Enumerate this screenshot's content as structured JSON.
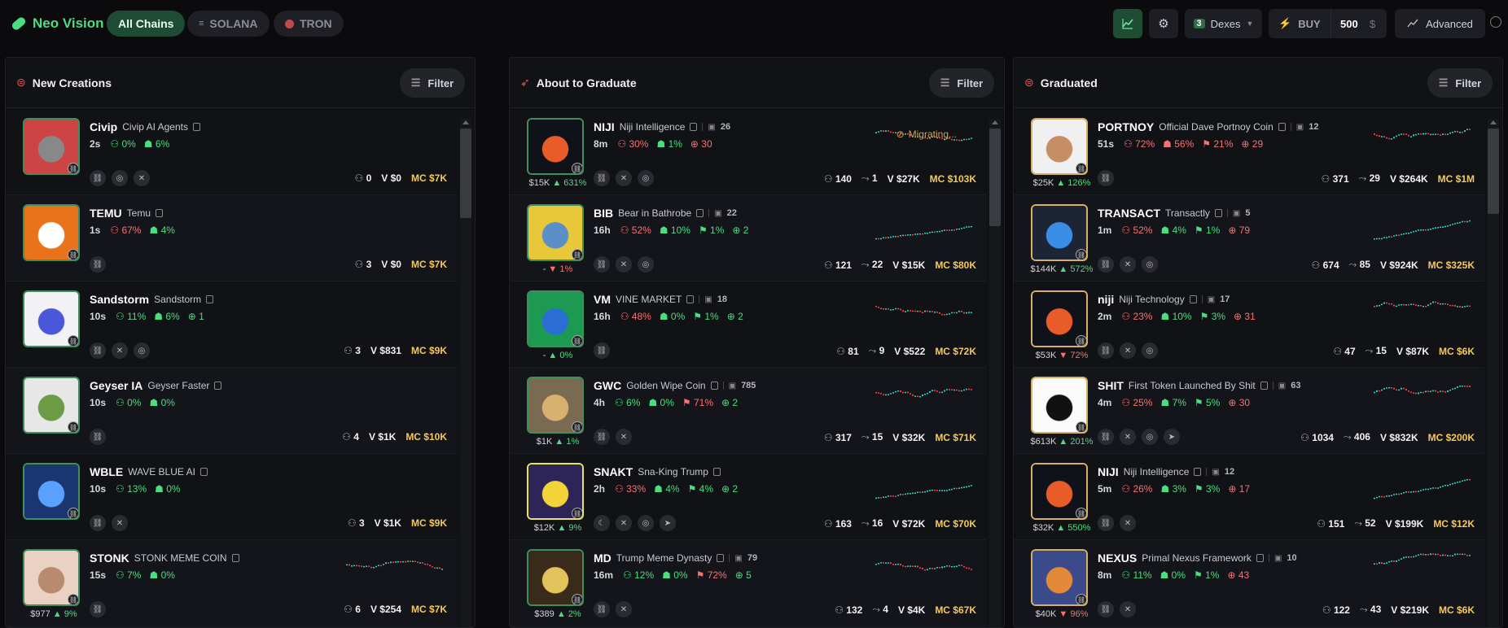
{
  "header": {
    "brand": "Neo Vision",
    "chains": [
      {
        "label": "All Chains"
      },
      {
        "label": "SOLANA"
      },
      {
        "label": "TRON"
      }
    ],
    "dexes_count": "3",
    "dexes_label": "Dexes",
    "buy_label": "BUY",
    "buy_amount": "500",
    "currency": "$",
    "advanced_label": "Advanced"
  },
  "columns": [
    {
      "title": "New Creations",
      "filter": "Filter",
      "rows": [
        {
          "ticker": "Civip",
          "name": "Civip AI Agents",
          "age": "2s",
          "holders": "0%",
          "dev": "6%",
          "socials": [
            "link",
            "web",
            "x"
          ],
          "h": "0",
          "v": "V $0",
          "mc": "MC $7K",
          "img": "#c44",
          "img2": "#888"
        },
        {
          "ticker": "TEMU",
          "name": "Temu",
          "age": "1s",
          "holders": "67%",
          "dev": "4%",
          "socials": [
            "link"
          ],
          "h": "3",
          "v": "V $0",
          "mc": "MC $7K",
          "img": "#e8731b",
          "img2": "#fff"
        },
        {
          "ticker": "Sandstorm",
          "name": "Sandstorm",
          "age": "10s",
          "holders": "11%",
          "dev": "6%",
          "extra": "1",
          "socials": [
            "link",
            "x",
            "web"
          ],
          "h": "3",
          "v": "V $831",
          "mc": "MC $9K",
          "img": "#f2f2f5",
          "img2": "#4a57d8"
        },
        {
          "ticker": "Geyser IA",
          "name": "Geyser Faster",
          "age": "10s",
          "holders": "0%",
          "dev": "0%",
          "socials": [
            "link"
          ],
          "h": "4",
          "v": "V $1K",
          "mc": "MC $10K",
          "img": "#e7e7e7",
          "img2": "#6c9b45"
        },
        {
          "ticker": "WBLE",
          "name": "WAVE BLUE AI",
          "age": "10s",
          "holders": "13%",
          "dev": "0%",
          "socials": [
            "link",
            "x"
          ],
          "h": "3",
          "v": "V $1K",
          "mc": "MC $9K",
          "img": "#1b3570",
          "img2": "#5aa0ff"
        },
        {
          "ticker": "STONK",
          "name": "STONK MEME COIN",
          "age": "15s",
          "holders": "7%",
          "dev": "0%",
          "socials": [
            "link"
          ],
          "h": "6",
          "v": "V $254",
          "mc": "MC $7K",
          "img": "#e9d2c2",
          "img2": "#b88a70",
          "mcap": "$977",
          "chg": "9%",
          "chgUp": true
        }
      ]
    },
    {
      "title": "About to Graduate",
      "filter": "Filter",
      "rows": [
        {
          "ticker": "NIJI",
          "name": "Niji Intelligence",
          "comments": "26",
          "age": "8m",
          "holders": "30%",
          "dev": "1%",
          "extra": "30",
          "socials": [
            "link",
            "x",
            "web"
          ],
          "h": "140",
          "tx": "1",
          "v": "V $27K",
          "mc": "MC $103K",
          "mig": "Migrating...",
          "mcap": "$15K",
          "chg": "631%",
          "chgUp": true,
          "img": "#0f1218",
          "img2": "#e85c2a"
        },
        {
          "ticker": "BIB",
          "name": "Bear in Bathrobe",
          "comments": "22",
          "age": "16h",
          "holders": "52%",
          "dev": "10%",
          "top": "1%",
          "extra": "2",
          "socials": [
            "link",
            "x",
            "web"
          ],
          "h": "121",
          "tx": "22",
          "v": "V $15K",
          "mc": "MC $80K",
          "mcap": "-",
          "chg": "1%",
          "chgUp": false,
          "img": "#e9c73a",
          "img2": "#5a8fc7"
        },
        {
          "ticker": "VM",
          "name": "VINE MARKET",
          "comments": "18",
          "age": "16h",
          "holders": "48%",
          "dev": "0%",
          "top": "1%",
          "extra": "2",
          "socials": [
            "link"
          ],
          "h": "81",
          "tx": "9",
          "v": "V $522",
          "mc": "MC $72K",
          "mcap": "-",
          "chg": "0%",
          "chgUp": true,
          "img": "#1d9a52",
          "img2": "#2a6ed4"
        },
        {
          "ticker": "GWC",
          "name": "Golden Wipe Coin",
          "comments": "785",
          "age": "4h",
          "holders": "6%",
          "dev": "0%",
          "top": "71%",
          "extra": "2",
          "socials": [
            "link",
            "x"
          ],
          "h": "317",
          "tx": "15",
          "v": "V $32K",
          "mc": "MC $71K",
          "mcap": "$1K",
          "chg": "1%",
          "chgUp": true,
          "img": "#7b6a52",
          "img2": "#d8b070"
        },
        {
          "ticker": "SNAKT",
          "name": "Sna-King Trump",
          "age": "2h",
          "holders": "33%",
          "dev": "4%",
          "top": "4%",
          "extra": "2",
          "socials": [
            "moon",
            "x",
            "web",
            "tg"
          ],
          "h": "163",
          "tx": "16",
          "v": "V $72K",
          "mc": "MC $70K",
          "mcap": "$12K",
          "chg": "9%",
          "chgUp": true,
          "img": "#2d2458",
          "img2": "#f3d33a"
        },
        {
          "ticker": "MD",
          "name": "Trump Meme Dynasty",
          "comments": "79",
          "age": "16m",
          "holders": "12%",
          "dev": "0%",
          "top": "72%",
          "extra": "5",
          "socials": [
            "link",
            "x"
          ],
          "h": "132",
          "tx": "4",
          "v": "V $4K",
          "mc": "MC $67K",
          "mcap": "$389",
          "chg": "2%",
          "chgUp": true,
          "img": "#3a2a1a",
          "img2": "#e2c25a"
        }
      ]
    },
    {
      "title": "Graduated",
      "filter": "Filter",
      "rows": [
        {
          "ticker": "PORTNOY",
          "name": "Official Dave Portnoy Coin",
          "comments": "12",
          "age": "51s",
          "holders": "72%",
          "dev": "56%",
          "top": "21%",
          "extra": "29",
          "socials": [
            "link"
          ],
          "h": "371",
          "tx": "29",
          "v": "V $264K",
          "mc": "MC $1M",
          "mcap": "$25K",
          "chg": "126%",
          "chgUp": true,
          "img": "#f0f0f0",
          "img2": "#c68e64"
        },
        {
          "ticker": "TRANSACT",
          "name": "Transactly",
          "comments": "5",
          "age": "1m",
          "holders": "52%",
          "dev": "4%",
          "top": "1%",
          "extra": "79",
          "socials": [
            "link",
            "x",
            "web"
          ],
          "h": "674",
          "tx": "85",
          "v": "V $924K",
          "mc": "MC $325K",
          "mcap": "$144K",
          "chg": "572%",
          "chgUp": true,
          "img": "#1c2436",
          "img2": "#3a8ee8"
        },
        {
          "ticker": "niji",
          "name": "Niji Technology",
          "comments": "17",
          "age": "2m",
          "holders": "23%",
          "dev": "10%",
          "top": "3%",
          "extra": "31",
          "socials": [
            "link",
            "x",
            "web"
          ],
          "h": "47",
          "tx": "15",
          "v": "V $87K",
          "mc": "MC $6K",
          "mcap": "$53K",
          "chg": "72%",
          "chgUp": false,
          "img": "#0f1218",
          "img2": "#e85c2a"
        },
        {
          "ticker": "SHIT",
          "name": "First Token Launched By Shit",
          "comments": "63",
          "age": "4m",
          "holders": "25%",
          "dev": "7%",
          "top": "5%",
          "extra": "30",
          "socials": [
            "link",
            "x",
            "web",
            "tg"
          ],
          "h": "1034",
          "tx": "406",
          "v": "V $832K",
          "mc": "MC $200K",
          "mcap": "$613K",
          "chg": "201%",
          "chgUp": true,
          "img": "#fafafa",
          "img2": "#111"
        },
        {
          "ticker": "NIJI",
          "name": "Niji Intelligence",
          "comments": "12",
          "age": "5m",
          "holders": "26%",
          "dev": "3%",
          "top": "3%",
          "extra": "17",
          "socials": [
            "link",
            "x"
          ],
          "h": "151",
          "tx": "52",
          "v": "V $199K",
          "mc": "MC $12K",
          "mcap": "$32K",
          "chg": "550%",
          "chgUp": true,
          "img": "#0f1218",
          "img2": "#e85c2a"
        },
        {
          "ticker": "NEXUS",
          "name": "Primal Nexus Framework",
          "comments": "10",
          "age": "8m",
          "holders": "11%",
          "dev": "0%",
          "top": "1%",
          "extra": "43",
          "socials": [
            "link",
            "x"
          ],
          "h": "122",
          "tx": "43",
          "v": "V $219K",
          "mc": "MC $6K",
          "mcap": "$40K",
          "chg": "96%",
          "chgUp": false,
          "img": "#3a4a8a",
          "img2": "#e28a3a"
        }
      ]
    }
  ],
  "colors": {
    "accent": "#4ade80",
    "negative": "#f87171",
    "mc": "#f4c95d",
    "migrating": "#c9a35a"
  }
}
